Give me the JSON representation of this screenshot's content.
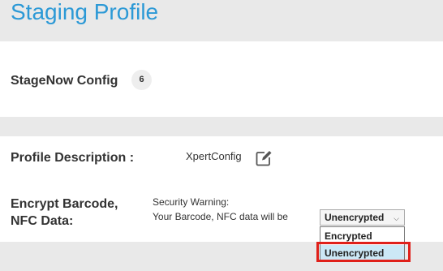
{
  "page": {
    "title": "Staging Profile"
  },
  "config": {
    "title": "StageNow Config",
    "badge_count": "6"
  },
  "profile": {
    "description_label": "Profile Description :",
    "description_value": "XpertConfig",
    "encrypt_label_line1": "Encrypt Barcode,",
    "encrypt_label_line2": "NFC Data:",
    "warning_line1": "Security Warning:",
    "warning_line2": "Your Barcode, NFC data will be",
    "encryption_select": {
      "selected": "Unencrypted",
      "options": [
        "Encrypted",
        "Unencrypted"
      ]
    }
  },
  "icons": {
    "edit": "edit-icon",
    "dropdown": "chevron-down-icon"
  },
  "colors": {
    "title_blue": "#2c99d6",
    "page_background": "#e9e9e9",
    "highlight_option": "#cce8f6",
    "annotation_red": "#e0201a"
  }
}
